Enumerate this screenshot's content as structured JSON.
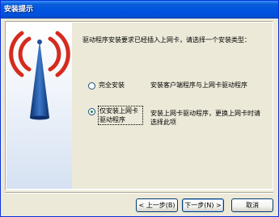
{
  "window": {
    "title": "安装提示"
  },
  "content": {
    "instruction": "驱动程序安装要求已经插入上网卡，请选择一个安装类型：",
    "options": [
      {
        "label": "完全安装",
        "description": "安装客户端程序与上网卡驱动程序",
        "selected": false
      },
      {
        "label": "仅安装上网卡驱动程序",
        "description": "安装上网卡驱动程序，更换上网卡时请选择此项",
        "selected": true
      }
    ]
  },
  "buttons": {
    "back": "< 上一步(B)",
    "next": "下一步(N) >",
    "cancel": "取消"
  },
  "colors": {
    "title_bar": "#0053e1",
    "background": "#ece9d8",
    "accent_red": "#d52b1e",
    "accent_blue": "#1f4f9a"
  },
  "icons": {
    "brand_art": "wireless-signal-icon"
  }
}
